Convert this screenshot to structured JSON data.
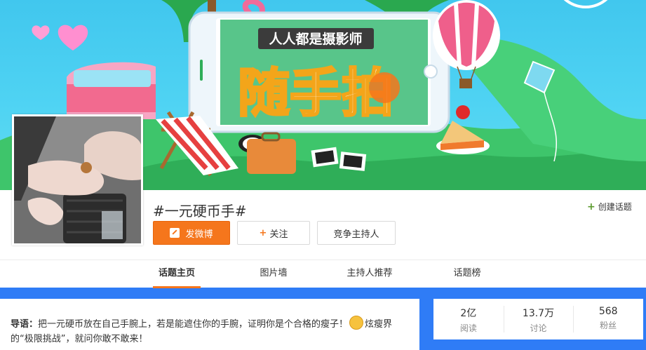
{
  "banner": {
    "headline": "人人都是摄影师",
    "title_art": "随手拍"
  },
  "topic": {
    "title": "#一元硬币手#",
    "create_topic_label": "创建话题"
  },
  "actions": {
    "post_label": "发微博",
    "follow_label": "关注",
    "host_label": "竞争主持人"
  },
  "tabs": [
    {
      "label": "话题主页",
      "active": true
    },
    {
      "label": "图片墙",
      "active": false
    },
    {
      "label": "主持人推荐",
      "active": false
    },
    {
      "label": "话题榜",
      "active": false
    }
  ],
  "intro": {
    "lead": "导语：",
    "text_before_emoji": "把一元硬币放在自己手腕上，若是能遮住你的手腕，证明你是个合格的瘦子！",
    "text_after_emoji": "炫瘦界的“极限挑战”，就问你敢不敢来！"
  },
  "stats": [
    {
      "value": "2亿",
      "label": "阅读"
    },
    {
      "value": "13.7万",
      "label": "讨论"
    },
    {
      "value": "568",
      "label": "粉丝"
    }
  ],
  "colors": {
    "accent": "#f5761c",
    "page_bg": "#2f7cf6",
    "banner_sky": "#4fd3f3"
  }
}
